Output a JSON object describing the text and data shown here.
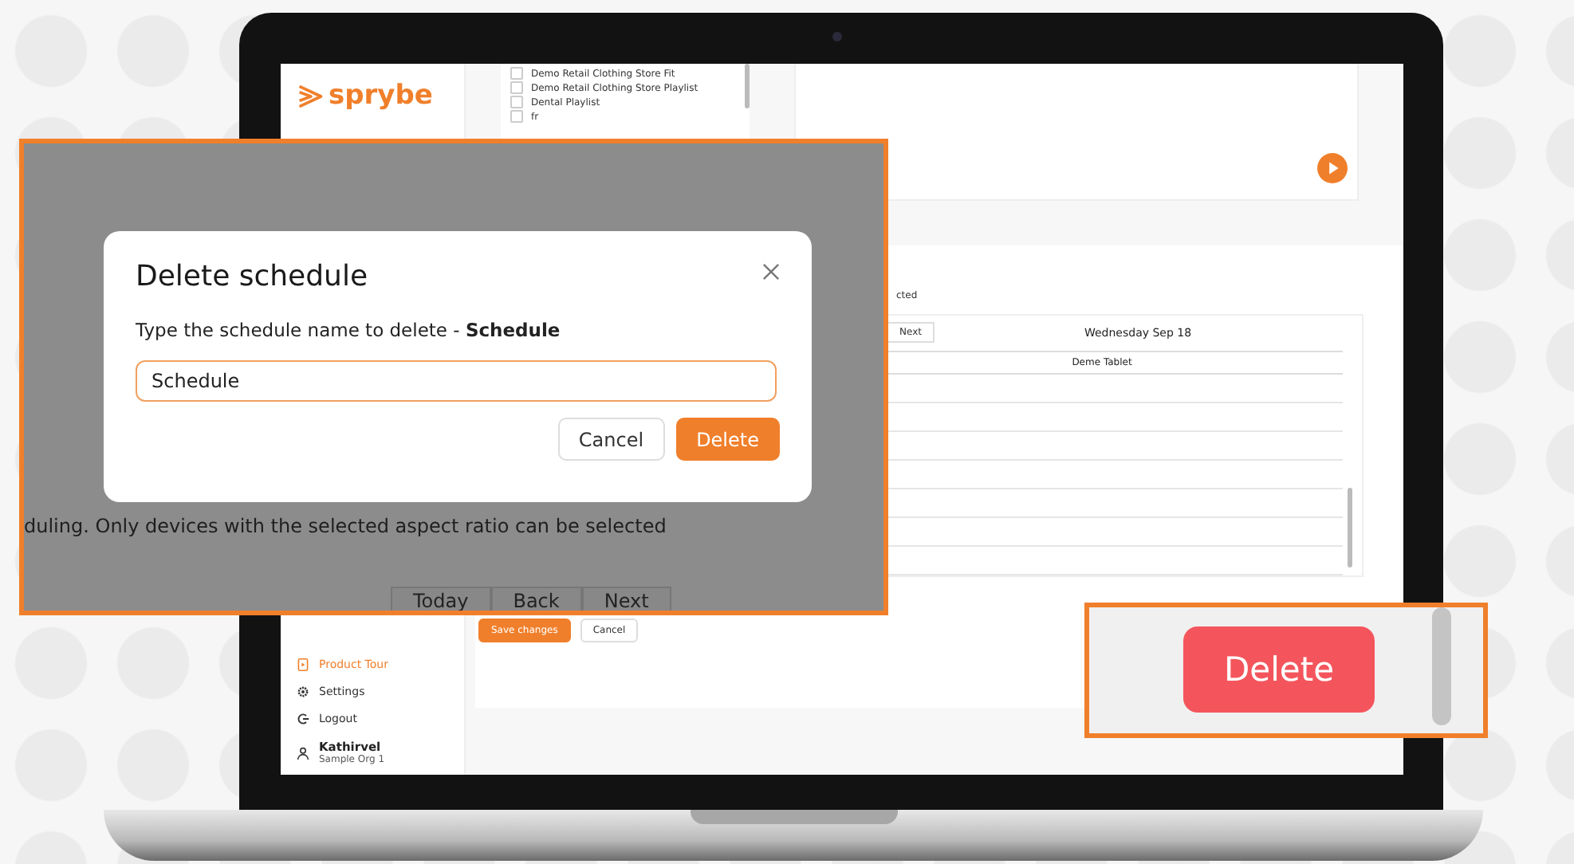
{
  "logo": {
    "text": "sprybe"
  },
  "playlists": [
    {
      "label": "Demo Retail Clothing Store Fit",
      "checked": false
    },
    {
      "label": "Demo Retail Clothing Store Playlist",
      "checked": false
    },
    {
      "label": "Dental Playlist",
      "checked": false
    },
    {
      "label": "fr",
      "checked": false
    }
  ],
  "sidebar": {
    "items": [
      {
        "label": "Product Tour",
        "kind": "tour",
        "selected": true
      },
      {
        "label": "Settings",
        "kind": "gear",
        "selected": false
      },
      {
        "label": "Logout",
        "kind": "logout",
        "selected": false
      }
    ],
    "user": {
      "name": "Kathirvel",
      "org": "Sample Org 1"
    }
  },
  "schedule": {
    "hint": "cted",
    "nav_buttons": [
      "Next"
    ],
    "date": "Wednesday Sep 18",
    "column": "Deme Tablet"
  },
  "actions": [
    {
      "label": "Save changes",
      "kind": "primary"
    },
    {
      "label": "Cancel",
      "kind": "secondary"
    }
  ],
  "dialog_callout": {
    "title": "Delete schedule",
    "prompt": "Type the schedule name to delete - **Schedule**",
    "value": "Schedule",
    "buttons": [
      {
        "label": "Cancel",
        "kind": "secondary"
      },
      {
        "label": "Delete",
        "kind": "primary"
      }
    ],
    "background_text": "duling. Only devices with the selected aspect ratio can be selected",
    "background_buttons": [
      "Today",
      "Back",
      "Next"
    ]
  },
  "button_callout": {
    "label": "Delete"
  }
}
